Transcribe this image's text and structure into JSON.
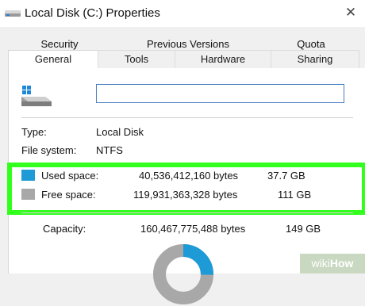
{
  "window": {
    "title": "Local Disk (C:) Properties",
    "close_glyph": "✕"
  },
  "tabs": {
    "row1": [
      "Security",
      "Previous Versions",
      "Quota"
    ],
    "row2": [
      "General",
      "Tools",
      "Hardware",
      "Sharing"
    ],
    "active": "General"
  },
  "general": {
    "name_value": "",
    "type_label": "Type:",
    "type_value": "Local Disk",
    "fs_label": "File system:",
    "fs_value": "NTFS",
    "used": {
      "label": "Used space:",
      "bytes": "40,536,412,160 bytes",
      "size": "37.7 GB",
      "color": "#1e9ad6"
    },
    "free": {
      "label": "Free space:",
      "bytes": "119,931,363,328 bytes",
      "size": "111 GB",
      "color": "#a8a8a8"
    },
    "capacity": {
      "label": "Capacity:",
      "bytes": "160,467,775,488 bytes",
      "size": "149 GB"
    },
    "used_fraction": 0.253
  },
  "highlight_color": "#33ff1f",
  "watermark": {
    "wiki": "wiki",
    "how": "How"
  }
}
